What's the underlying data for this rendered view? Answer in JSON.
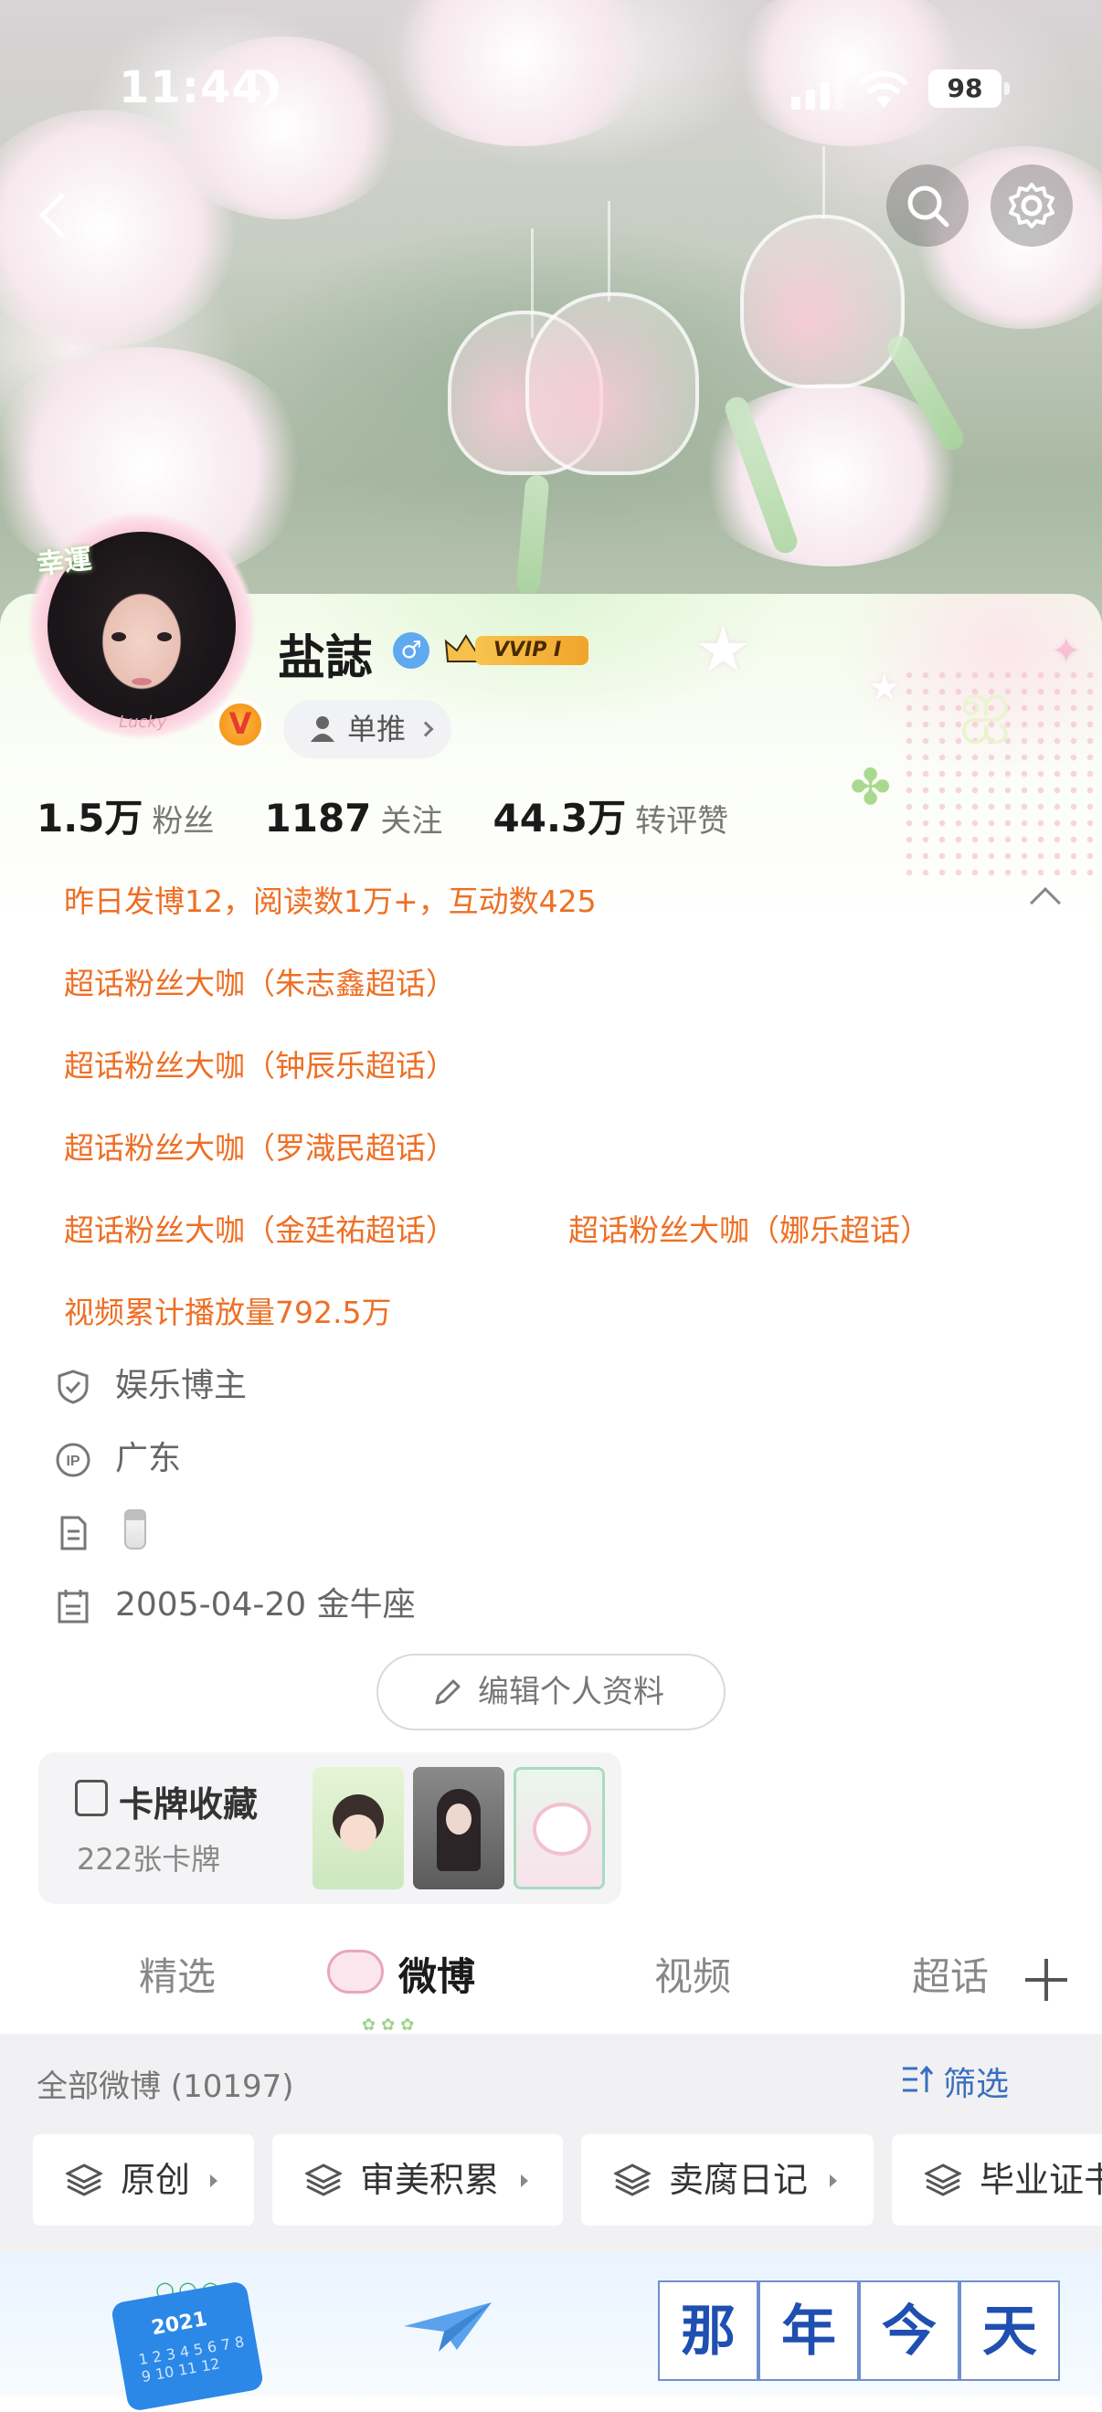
{
  "status_bar": {
    "time": "11:44",
    "battery": "98"
  },
  "profile": {
    "name": "盐誌",
    "gender_symbol": "♂",
    "vip_label": "VVIP Ⅰ",
    "avatar_tag": "幸運",
    "avatar_small_tag": "Lucky",
    "verified_badge": "V",
    "tuijian_label": "单推"
  },
  "stats": [
    {
      "num": "1.5万",
      "label": "粉丝"
    },
    {
      "num": "1187",
      "label": "关注"
    },
    {
      "num": "44.3万",
      "label": "转评赞"
    }
  ],
  "highlights": {
    "summary": "昨日发博12，阅读数1万+，互动数425",
    "badges": [
      "超话粉丝大咖（朱志鑫超话）",
      "超话粉丝大咖（钟辰乐超话）",
      "超话粉丝大咖（罗渽民超话）",
      "超话粉丝大咖（金廷祐超话）",
      "超话粉丝大咖（娜乐超话）"
    ],
    "video_plays": "视频累计播放量792.5万"
  },
  "info": {
    "category": "娱乐博主",
    "ip": "广东",
    "birthday": "2005-04-20 金牛座",
    "icons": [
      "shield-icon",
      "ip-icon",
      "document-icon",
      "calendar-icon"
    ]
  },
  "edit_profile_label": "编辑个人资料",
  "card_collection": {
    "title": "卡牌收藏",
    "count": "222张卡牌"
  },
  "tabs": [
    "精选",
    "微博",
    "视频",
    "超话"
  ],
  "active_tab": "微博",
  "feed": {
    "count_label": "全部微博 (10197)",
    "filter_label": "筛选",
    "chips": [
      "原创",
      "审美积累",
      "卖腐日记",
      "毕业证书"
    ]
  },
  "promo": {
    "calendar_year": "2021",
    "calendar_nums": "1 2 3 4 5 6 7 8 9 10 11 12",
    "title_chars": [
      "那",
      "年",
      "今",
      "天"
    ]
  },
  "colors": {
    "accent_orange": "#ee6f24",
    "link_blue": "#3a6fbf",
    "vip_gold": "#f0a52a"
  }
}
